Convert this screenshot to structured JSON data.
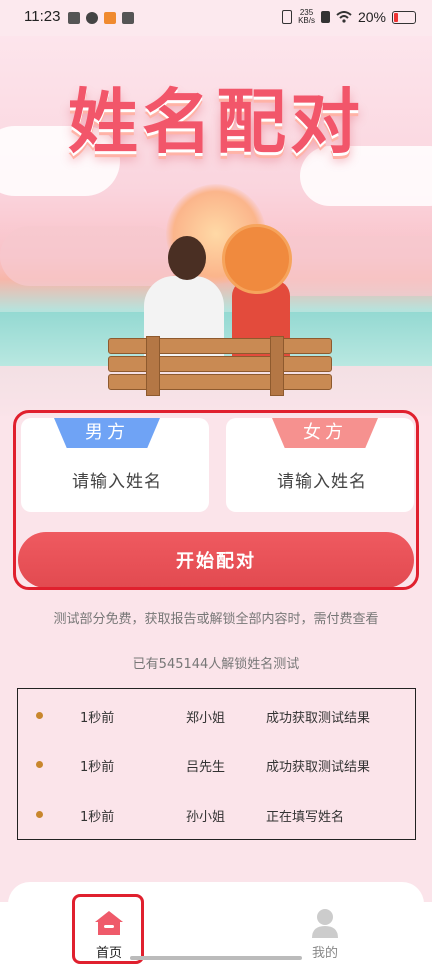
{
  "status_bar": {
    "time": "11:23",
    "net_speed_value": "235",
    "net_speed_unit": "KB/s",
    "battery": "20%"
  },
  "hero": {
    "title": "姓名配对"
  },
  "form": {
    "male_tab": "男方",
    "female_tab": "女方",
    "male_placeholder": "请输入姓名",
    "female_placeholder": "请输入姓名",
    "start_button": "开始配对"
  },
  "notice": "测试部分免费，获取报告或解锁全部内容时，需付费查看",
  "unlock_count": "已有545144人解锁姓名测试",
  "activity": [
    {
      "time": "1秒前",
      "user": "郑小姐",
      "status": "成功获取测试结果"
    },
    {
      "time": "1秒前",
      "user": "吕先生",
      "status": "成功获取测试结果"
    },
    {
      "time": "1秒前",
      "user": "孙小姐",
      "status": "正在填写姓名"
    }
  ],
  "tabbar": {
    "home": "首页",
    "mine": "我的"
  },
  "colors": {
    "accent": "#e24a50",
    "male": "#6fa3f5",
    "female": "#f6918f",
    "highlight_box": "#e0202e"
  }
}
